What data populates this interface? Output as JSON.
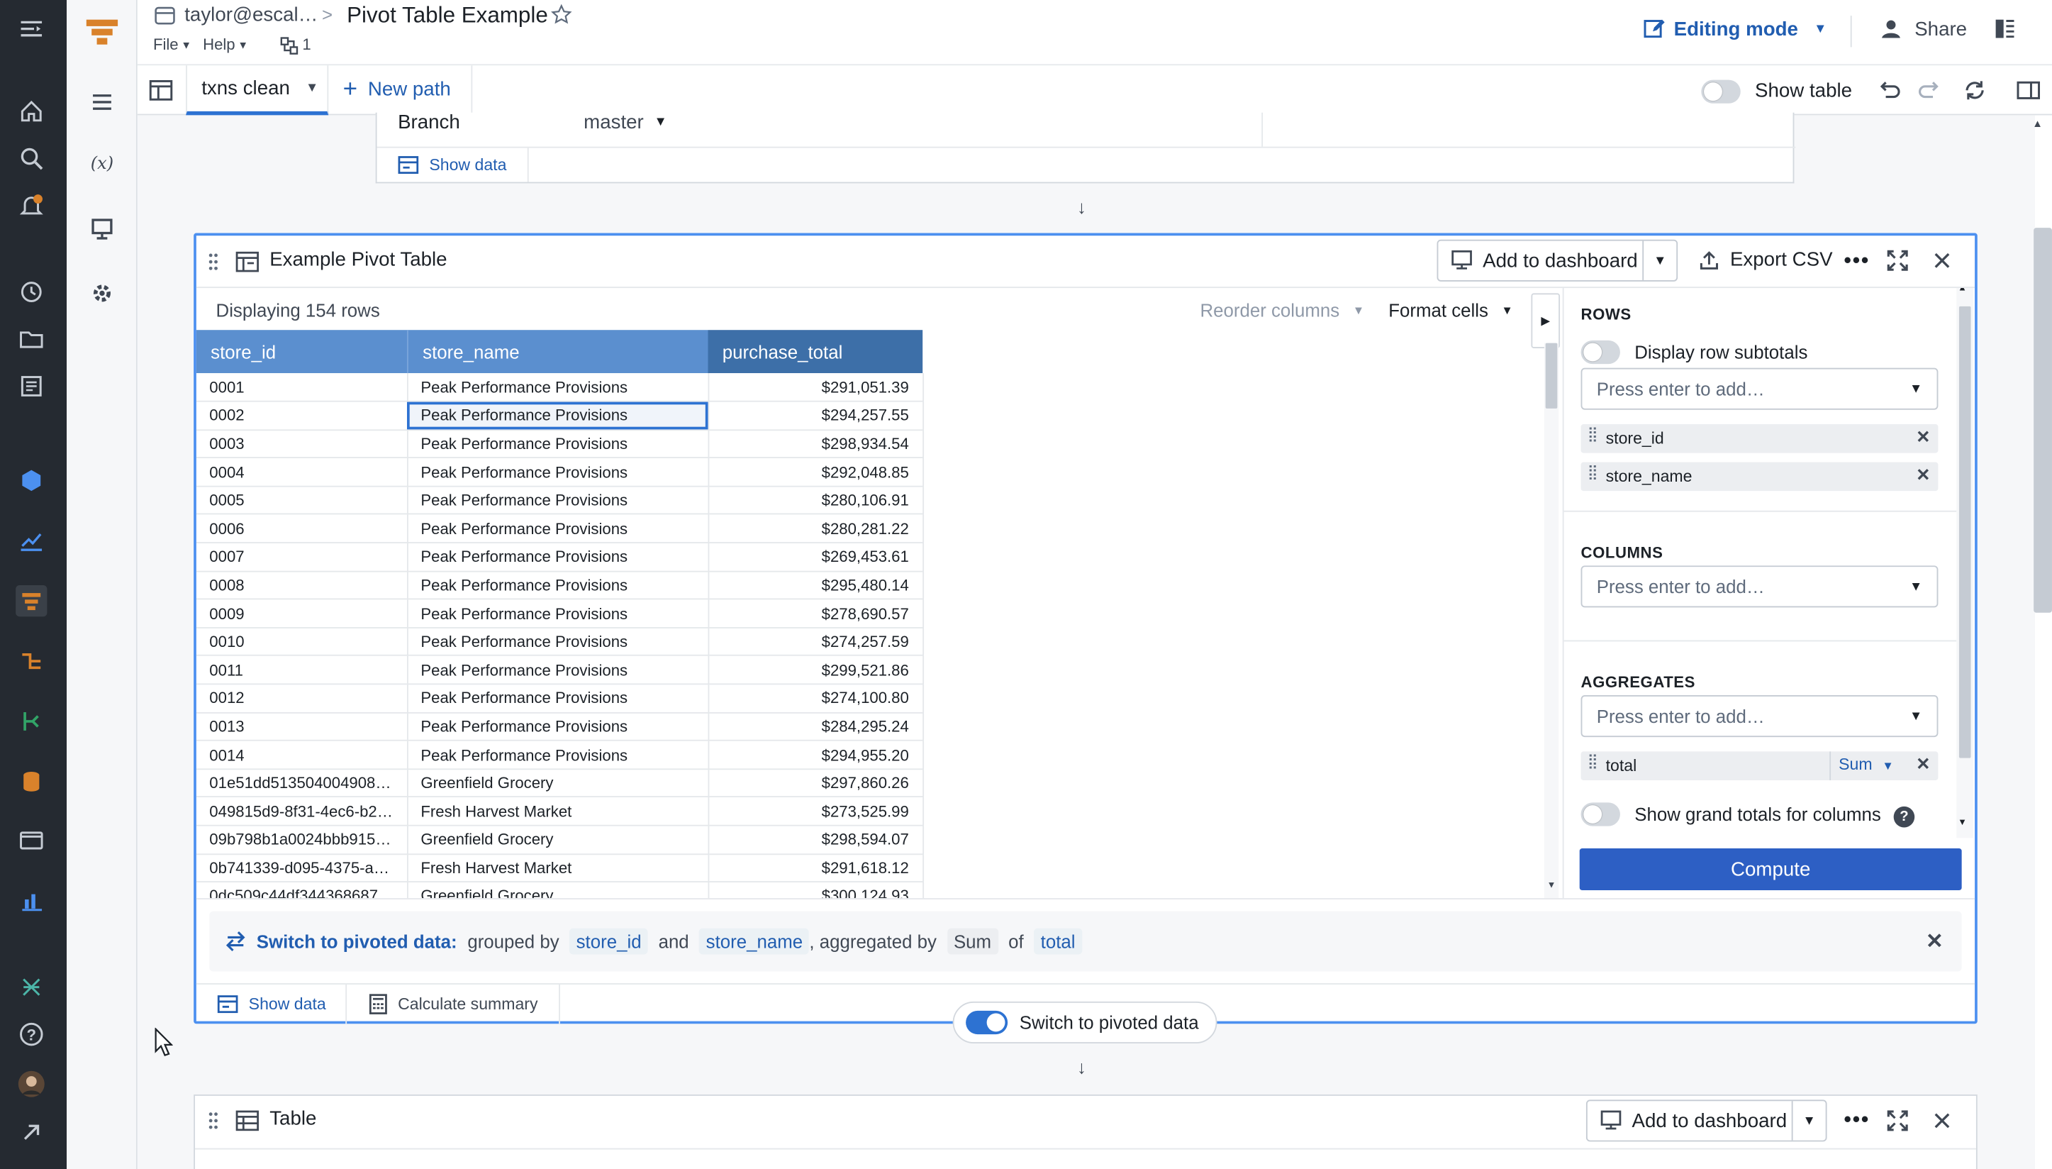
{
  "header": {
    "breadcrumb_owner": "taylor@escal…",
    "breadcrumb_sep": ">",
    "title": "Pivot Table Example",
    "menu_file": "File",
    "menu_help": "Help",
    "graph_count": "1",
    "mode_label": "Editing mode",
    "share_label": "Share"
  },
  "toolbar": {
    "path_tab": "txns clean",
    "new_path": "New path",
    "show_table": "Show table"
  },
  "upper_card": {
    "branch_label": "Branch",
    "branch_value": "master",
    "show_data": "Show data"
  },
  "pivot": {
    "title": "Example Pivot Table",
    "add_to_dashboard": "Add to dashboard",
    "export_csv": "Export CSV",
    "displaying": "Displaying 154 rows",
    "reorder_columns": "Reorder columns",
    "format_cells": "Format cells",
    "columns": [
      "store_id",
      "store_name",
      "purchase_total"
    ],
    "rows": [
      [
        "0001",
        "Peak Performance Provisions",
        "$291,051.39"
      ],
      [
        "0002",
        "Peak Performance Provisions",
        "$294,257.55"
      ],
      [
        "0003",
        "Peak Performance Provisions",
        "$298,934.54"
      ],
      [
        "0004",
        "Peak Performance Provisions",
        "$292,048.85"
      ],
      [
        "0005",
        "Peak Performance Provisions",
        "$280,106.91"
      ],
      [
        "0006",
        "Peak Performance Provisions",
        "$280,281.22"
      ],
      [
        "0007",
        "Peak Performance Provisions",
        "$269,453.61"
      ],
      [
        "0008",
        "Peak Performance Provisions",
        "$295,480.14"
      ],
      [
        "0009",
        "Peak Performance Provisions",
        "$278,690.57"
      ],
      [
        "0010",
        "Peak Performance Provisions",
        "$274,257.59"
      ],
      [
        "0011",
        "Peak Performance Provisions",
        "$299,521.86"
      ],
      [
        "0012",
        "Peak Performance Provisions",
        "$274,100.80"
      ],
      [
        "0013",
        "Peak Performance Provisions",
        "$284,295.24"
      ],
      [
        "0014",
        "Peak Performance Provisions",
        "$294,955.20"
      ],
      [
        "01e51dd513504004908…",
        "Greenfield Grocery",
        "$297,860.26"
      ],
      [
        "049815d9-8f31-4ec6-b2…",
        "Fresh Harvest Market",
        "$273,525.99"
      ],
      [
        "09b798b1a0024bbb915…",
        "Greenfield Grocery",
        "$298,594.07"
      ],
      [
        "0b741339-d095-4375-a…",
        "Fresh Harvest Market",
        "$291,618.12"
      ],
      [
        "0dc509c44df344368687…",
        "Greenfield Grocery",
        "$300,124.93"
      ]
    ],
    "config": {
      "rows_label": "ROWS",
      "display_row_subtotals": "Display row subtotals",
      "placeholder": "Press enter to add…",
      "row_tags": [
        "store_id",
        "store_name"
      ],
      "columns_label": "COLUMNS",
      "aggregates_label": "AGGREGATES",
      "agg_field": "total",
      "agg_func": "Sum",
      "grand_totals": "Show grand totals for columns",
      "compute": "Compute"
    },
    "banner": {
      "lead": "Switch to pivoted data:",
      "grouped_by": "grouped by",
      "field1": "store_id",
      "and": "and",
      "field2": "store_name",
      "aggregated_by": ", aggregated by",
      "func": "Sum",
      "of": "of",
      "field3": "total"
    },
    "show_data": "Show data",
    "calc_summary": "Calculate summary",
    "switch_label": "Switch to pivoted data"
  },
  "lower_card": {
    "title": "Table",
    "add_to_dashboard": "Add to dashboard"
  },
  "colors": {
    "rail": "#252a31",
    "accent": "#2d72d2",
    "header_col_light": "#5b8fcf",
    "header_col_dark": "#3d6fa8",
    "compute": "#2d5fc4",
    "brand_orange": "#d9822b"
  }
}
